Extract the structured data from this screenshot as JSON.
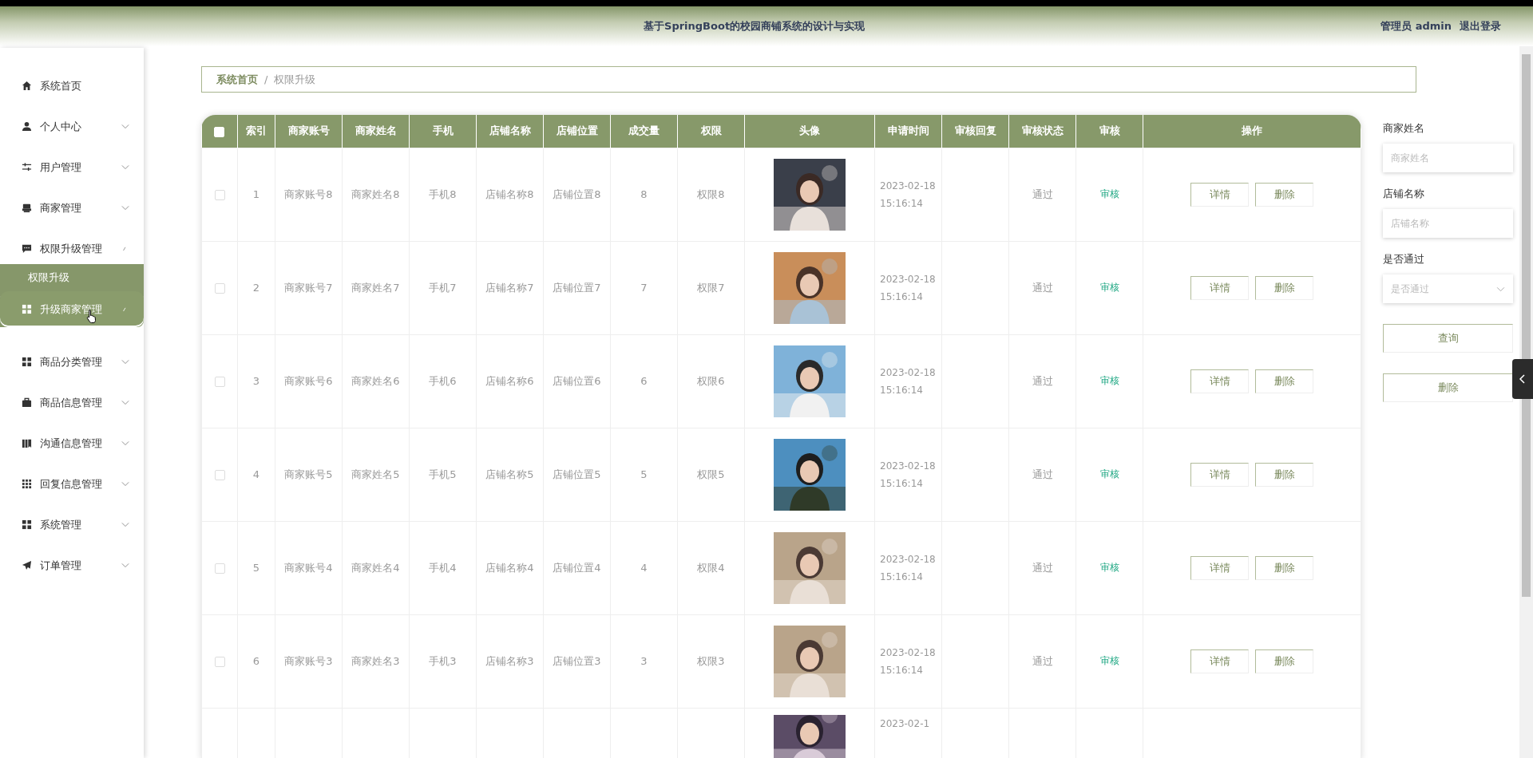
{
  "header": {
    "title": "基于SpringBoot的校园商铺系统的设计与实现",
    "user": "管理员 admin",
    "logout": "退出登录"
  },
  "sidebar": {
    "items": [
      {
        "kind": "link",
        "label": "系统首页"
      },
      {
        "kind": "menu",
        "label": "个人中心",
        "expanded": false
      },
      {
        "kind": "menu",
        "label": "用户管理",
        "expanded": false
      },
      {
        "kind": "menu",
        "label": "商家管理",
        "expanded": false
      },
      {
        "kind": "menu",
        "label": "权限升级管理",
        "expanded": true,
        "flyout_title": "权限升级",
        "children": [
          {
            "label": "升级商家管理",
            "selected": true
          }
        ]
      },
      {
        "kind": "menu",
        "label": "商品分类管理",
        "expanded": false
      },
      {
        "kind": "menu",
        "label": "商品信息管理",
        "expanded": false
      },
      {
        "kind": "menu",
        "label": "沟通信息管理",
        "expanded": false
      },
      {
        "kind": "menu",
        "label": "回复信息管理",
        "expanded": false
      },
      {
        "kind": "menu",
        "label": "系统管理",
        "expanded": false
      },
      {
        "kind": "menu",
        "label": "订单管理",
        "expanded": false
      }
    ]
  },
  "breadcrumb": {
    "items": [
      "系统首页",
      "权限升级"
    ],
    "separator": "/"
  },
  "table": {
    "select_all_checked": false,
    "columns": [
      "索引",
      "商家账号",
      "商家姓名",
      "手机",
      "店铺名称",
      "店铺位置",
      "成交量",
      "权限",
      "头像",
      "申请时间",
      "审核回复",
      "审核状态",
      "审核",
      "操作"
    ],
    "rows": [
      {
        "checked": false,
        "cells": [
          "1",
          "商家账号8",
          "商家姓名8",
          "手机8",
          "店铺名称8",
          "店铺位置8",
          "8",
          "权限8"
        ],
        "time": "2023-02-18 15:16:14",
        "status": "通过",
        "review": "审核",
        "actions": [
          "详情",
          "删除"
        ]
      },
      {
        "checked": false,
        "cells": [
          "2",
          "商家账号7",
          "商家姓名7",
          "手机7",
          "店铺名称7",
          "店铺位置7",
          "7",
          "权限7"
        ],
        "time": "2023-02-18 15:16:14",
        "status": "通过",
        "review": "审核",
        "actions": [
          "详情",
          "删除"
        ]
      },
      {
        "checked": false,
        "cells": [
          "3",
          "商家账号6",
          "商家姓名6",
          "手机6",
          "店铺名称6",
          "店铺位置6",
          "6",
          "权限6"
        ],
        "time": "2023-02-18 15:16:14",
        "status": "通过",
        "review": "审核",
        "actions": [
          "详情",
          "删除"
        ]
      },
      {
        "checked": false,
        "cells": [
          "4",
          "商家账号5",
          "商家姓名5",
          "手机5",
          "店铺名称5",
          "店铺位置5",
          "5",
          "权限5"
        ],
        "time": "2023-02-18 15:16:14",
        "status": "通过",
        "review": "审核",
        "actions": [
          "详情",
          "删除"
        ]
      },
      {
        "checked": false,
        "cells": [
          "5",
          "商家账号4",
          "商家姓名4",
          "手机4",
          "店铺名称4",
          "店铺位置4",
          "4",
          "权限4"
        ],
        "time": "2023-02-18 15:16:14",
        "status": "通过",
        "review": "审核",
        "actions": [
          "详情",
          "删除"
        ]
      },
      {
        "checked": false,
        "cells": [
          "6",
          "商家账号3",
          "商家姓名3",
          "手机3",
          "店铺名称3",
          "店铺位置3",
          "3",
          "权限3"
        ],
        "time": "2023-02-18 15:16:14",
        "status": "通过",
        "review": "审核",
        "actions": [
          "详情",
          "删除"
        ]
      },
      {
        "kind": "partial",
        "time": "2023-02-1"
      }
    ]
  },
  "filters": {
    "fields": [
      {
        "kind": "input",
        "label": "商家姓名",
        "placeholder": "商家姓名"
      },
      {
        "kind": "input",
        "label": "店铺名称",
        "placeholder": "店铺名称"
      },
      {
        "kind": "select",
        "label": "是否通过",
        "placeholder": "是否通过"
      }
    ],
    "buttons": [
      "查询",
      "删除"
    ]
  }
}
